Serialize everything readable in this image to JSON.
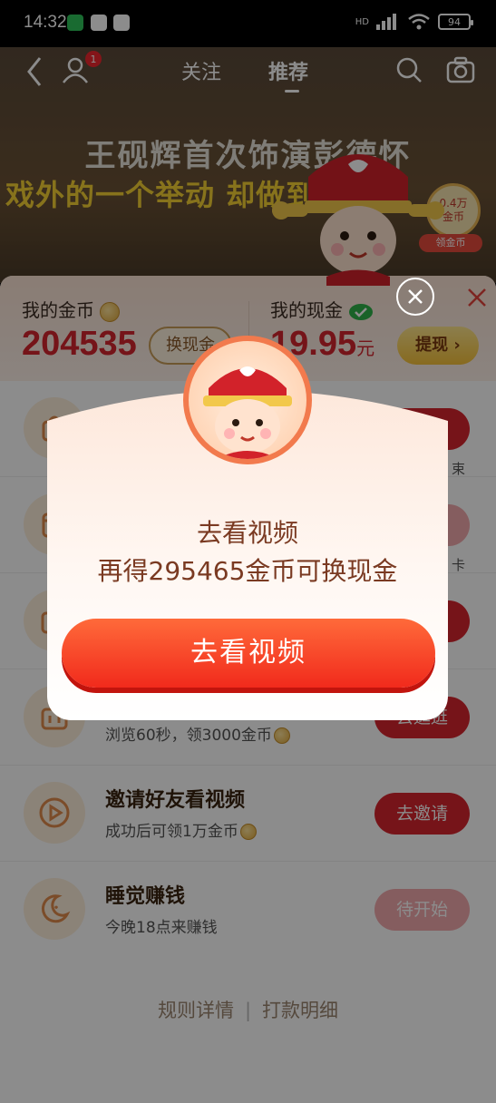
{
  "status_bar": {
    "time": "14:32",
    "battery": "94",
    "network": "HD"
  },
  "top_nav": {
    "notif_count": "1",
    "tabs": [
      {
        "label": "关注"
      },
      {
        "label": "推荐"
      }
    ]
  },
  "video": {
    "headline1": "王砚辉首次饰演彭德怀",
    "headline2": "戏外的一个举动 却做到了“",
    "coin_amount": "0.4万",
    "coin_label": "金币",
    "coin_tag": "领金币"
  },
  "wallet": {
    "coins_label": "我的金币",
    "coins_value": "204535",
    "exchange_btn": "换现金",
    "cash_label": "我的现金",
    "cash_value": "19.95",
    "cash_unit": "元",
    "withdraw_btn": "提现"
  },
  "tasks": [
    {
      "title": "",
      "sub": "",
      "btn": "",
      "partial_right": "束"
    },
    {
      "title": "",
      "sub": "",
      "btn": "",
      "partial_right": "卡"
    },
    {
      "title": "",
      "sub": "",
      "btn": ""
    },
    {
      "title": "",
      "sub": "浏览60秒，领3000金币",
      "btn": "去逛逛"
    },
    {
      "title": "邀请好友看视频",
      "sub": "成功后可领1万金币",
      "btn": "去邀请"
    },
    {
      "title": "睡觉赚钱",
      "sub": "今晚18点来赚钱",
      "btn": "待开始"
    }
  ],
  "footer": {
    "rules": "规则详情",
    "records": "打款明细"
  },
  "modal": {
    "line1": "去看视频",
    "line2": "再得295465金币可换现金",
    "cta": "去看视频"
  }
}
